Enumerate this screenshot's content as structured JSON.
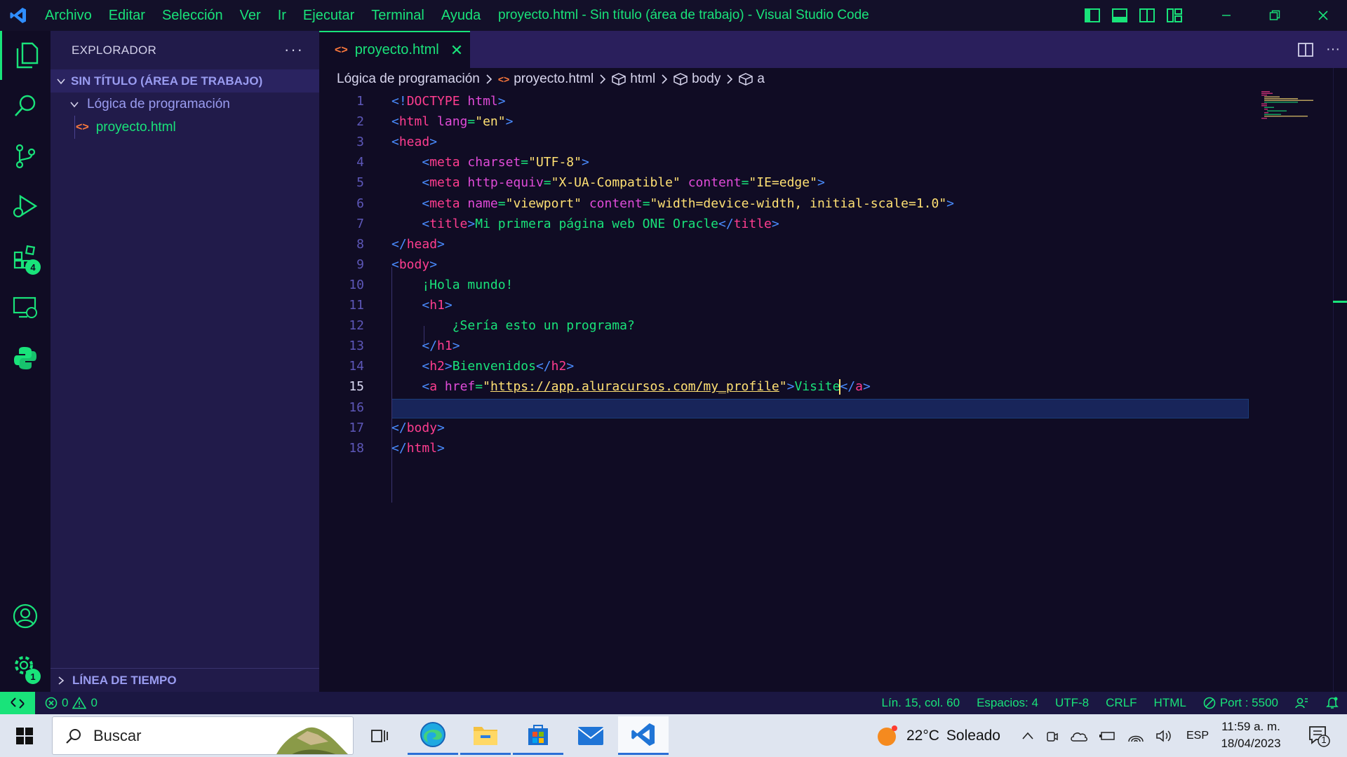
{
  "window": {
    "title": "proyecto.html - Sin título (área de trabajo) - Visual Studio Code",
    "menu": [
      "Archivo",
      "Editar",
      "Selección",
      "Ver",
      "Ir",
      "Ejecutar",
      "Terminal",
      "Ayuda"
    ]
  },
  "activity_bar": {
    "extensions_badge": "4",
    "settings_badge": "1"
  },
  "sidebar": {
    "header": "EXPLORADOR",
    "workspace": "SIN TÍTULO (ÁREA DE TRABAJO)",
    "folder": "Lógica de programación",
    "file": "proyecto.html",
    "timeline": "LÍNEA DE TIEMPO"
  },
  "editor": {
    "tab_label": "proyecto.html",
    "breadcrumbs": [
      "Lógica de programación",
      "proyecto.html",
      "html",
      "body",
      "a"
    ],
    "current_line": 15,
    "lines": [
      [
        [
          "b",
          "<!"
        ],
        [
          "t",
          "DOCTYPE"
        ],
        [
          "x",
          " "
        ],
        [
          "a",
          "html"
        ],
        [
          "b",
          ">"
        ]
      ],
      [
        [
          "b",
          "<"
        ],
        [
          "t",
          "html"
        ],
        [
          "x",
          " "
        ],
        [
          "a",
          "lang"
        ],
        [
          "x",
          "="
        ],
        [
          "s",
          "\"en\""
        ],
        [
          "b",
          ">"
        ]
      ],
      [
        [
          "b",
          "<"
        ],
        [
          "t",
          "head"
        ],
        [
          "b",
          ">"
        ]
      ],
      [
        [
          "x",
          "    "
        ],
        [
          "b",
          "<"
        ],
        [
          "t",
          "meta"
        ],
        [
          "x",
          " "
        ],
        [
          "a",
          "charset"
        ],
        [
          "x",
          "="
        ],
        [
          "s",
          "\"UTF-8\""
        ],
        [
          "b",
          ">"
        ]
      ],
      [
        [
          "x",
          "    "
        ],
        [
          "b",
          "<"
        ],
        [
          "t",
          "meta"
        ],
        [
          "x",
          " "
        ],
        [
          "a",
          "http-equiv"
        ],
        [
          "x",
          "="
        ],
        [
          "s",
          "\"X-UA-Compatible\""
        ],
        [
          "x",
          " "
        ],
        [
          "a",
          "content"
        ],
        [
          "x",
          "="
        ],
        [
          "s",
          "\"IE=edge\""
        ],
        [
          "b",
          ">"
        ]
      ],
      [
        [
          "x",
          "    "
        ],
        [
          "b",
          "<"
        ],
        [
          "t",
          "meta"
        ],
        [
          "x",
          " "
        ],
        [
          "a",
          "name"
        ],
        [
          "x",
          "="
        ],
        [
          "s",
          "\"viewport\""
        ],
        [
          "x",
          " "
        ],
        [
          "a",
          "content"
        ],
        [
          "x",
          "="
        ],
        [
          "s",
          "\"width=device-width, initial-scale=1.0\""
        ],
        [
          "b",
          ">"
        ]
      ],
      [
        [
          "x",
          "    "
        ],
        [
          "b",
          "<"
        ],
        [
          "t",
          "title"
        ],
        [
          "b",
          ">"
        ],
        [
          "x",
          "Mi primera página web ONE Oracle"
        ],
        [
          "b",
          "</"
        ],
        [
          "t",
          "title"
        ],
        [
          "b",
          ">"
        ]
      ],
      [
        [
          "b",
          "</"
        ],
        [
          "t",
          "head"
        ],
        [
          "b",
          ">"
        ]
      ],
      [
        [
          "b",
          "<"
        ],
        [
          "t",
          "body"
        ],
        [
          "b",
          ">"
        ]
      ],
      [
        [
          "x",
          "    ¡Hola mundo!"
        ]
      ],
      [
        [
          "x",
          "    "
        ],
        [
          "b",
          "<"
        ],
        [
          "t",
          "h1"
        ],
        [
          "b",
          ">"
        ]
      ],
      [
        [
          "x",
          "        ¿Sería esto un programa?"
        ]
      ],
      [
        [
          "x",
          "    "
        ],
        [
          "b",
          "</"
        ],
        [
          "t",
          "h1"
        ],
        [
          "b",
          ">"
        ]
      ],
      [
        [
          "x",
          "    "
        ],
        [
          "b",
          "<"
        ],
        [
          "t",
          "h2"
        ],
        [
          "b",
          ">"
        ],
        [
          "x",
          "Bienvenidos"
        ],
        [
          "b",
          "</"
        ],
        [
          "t",
          "h2"
        ],
        [
          "b",
          ">"
        ]
      ],
      [
        [
          "x",
          "    "
        ],
        [
          "b",
          "<"
        ],
        [
          "t",
          "a"
        ],
        [
          "x",
          " "
        ],
        [
          "a",
          "href"
        ],
        [
          "x",
          "="
        ],
        [
          "s",
          "\""
        ],
        [
          "u",
          "https://app.aluracursos.com/my_profile"
        ],
        [
          "s",
          "\""
        ],
        [
          "b",
          ">"
        ],
        [
          "x",
          "Visite"
        ],
        [
          "c",
          ""
        ],
        [
          "b",
          "</"
        ],
        [
          "t",
          "a"
        ],
        [
          "b",
          ">"
        ]
      ],
      [],
      [
        [
          "b",
          "</"
        ],
        [
          "t",
          "body"
        ],
        [
          "b",
          ">"
        ]
      ],
      [
        [
          "b",
          "</"
        ],
        [
          "t",
          "html"
        ],
        [
          "b",
          ">"
        ]
      ]
    ]
  },
  "status_bar": {
    "errors": "0",
    "warnings": "0",
    "position": "Lín. 15, col. 60",
    "spaces": "Espacios: 4",
    "encoding": "UTF-8",
    "eol": "CRLF",
    "language": "HTML",
    "port": "Port : 5500"
  },
  "taskbar": {
    "search_placeholder": "Buscar",
    "temperature": "22°C",
    "weather": "Soleado",
    "language": "ESP",
    "time": "11:59 a. m.",
    "date": "18/04/2023",
    "notifications": "1"
  },
  "colors": {
    "accent": "#19e37a",
    "tag": "#ff3d8f",
    "bracket": "#4a8cff",
    "attribute": "#e04bd8",
    "string": "#ffe073",
    "background": "#100c24",
    "sidebar": "#211b4a"
  },
  "icons": [
    "vscode-logo-icon",
    "files-icon",
    "search-icon",
    "source-control-icon",
    "run-debug-icon",
    "extensions-icon",
    "remote-explorer-icon",
    "python-icon",
    "account-icon",
    "settings-gear-icon"
  ]
}
